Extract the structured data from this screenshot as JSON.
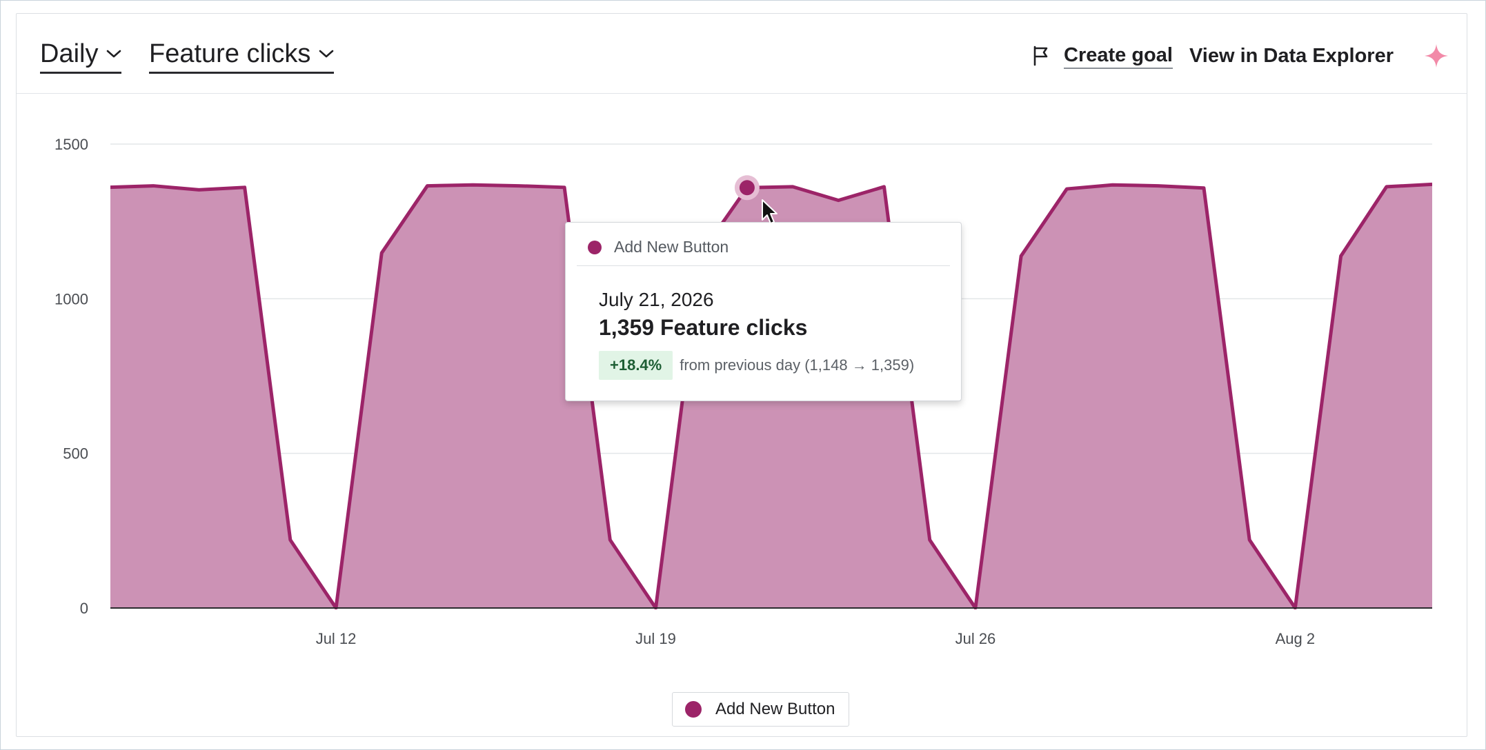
{
  "header": {
    "interval_dropdown": "Daily",
    "metric_dropdown": "Feature clicks",
    "create_goal_label": "Create goal",
    "data_explorer_label": "View in Data Explorer",
    "icons": [
      "chevron-down-icon",
      "flag-icon",
      "sparkle-icon"
    ]
  },
  "colors": {
    "series_line": "#9c2468",
    "series_fill": "#cc92b5",
    "sparkle": "#f28aa8",
    "badge_bg": "#e1f4e6",
    "badge_text": "#1d5e34"
  },
  "chart_data": {
    "type": "area",
    "x": [
      "2026-07-07",
      "2026-07-08",
      "2026-07-09",
      "2026-07-10",
      "2026-07-11",
      "2026-07-12",
      "2026-07-13",
      "2026-07-14",
      "2026-07-15",
      "2026-07-16",
      "2026-07-17",
      "2026-07-18",
      "2026-07-19",
      "2026-07-20",
      "2026-07-21",
      "2026-07-22",
      "2026-07-23",
      "2026-07-24",
      "2026-07-25",
      "2026-07-26",
      "2026-07-27",
      "2026-07-28",
      "2026-07-29",
      "2026-07-30",
      "2026-07-31",
      "2026-08-01",
      "2026-08-02",
      "2026-08-03",
      "2026-08-04",
      "2026-08-05"
    ],
    "series": [
      {
        "name": "Add New Button",
        "values": [
          1360,
          1365,
          1352,
          1360,
          220,
          0,
          1148,
          1365,
          1368,
          1365,
          1360,
          220,
          0,
          1148,
          1359,
          1362,
          1318,
          1362,
          220,
          0,
          1138,
          1355,
          1368,
          1365,
          1358,
          220,
          0,
          1138,
          1362,
          1370
        ]
      }
    ],
    "x_tick_labels": [
      "Jul 12",
      "Jul 19",
      "Jul 26",
      "Aug 2"
    ],
    "x_tick_dates": [
      "2026-07-12",
      "2026-07-19",
      "2026-07-26",
      "2026-08-02"
    ],
    "y_ticks": [
      0,
      500,
      1000,
      1500
    ],
    "ylim": [
      0,
      1500
    ],
    "grid": true,
    "legend": "bottom-center",
    "highlighted_date": "2026-07-21"
  },
  "tooltip": {
    "series_name": "Add New Button",
    "date": "July 21, 2026",
    "value_text": "1,359 Feature clicks",
    "change_badge": "+18.4%",
    "change_text": "from previous day (1,148 → 1,359)"
  },
  "legend": {
    "series_name": "Add New Button"
  }
}
